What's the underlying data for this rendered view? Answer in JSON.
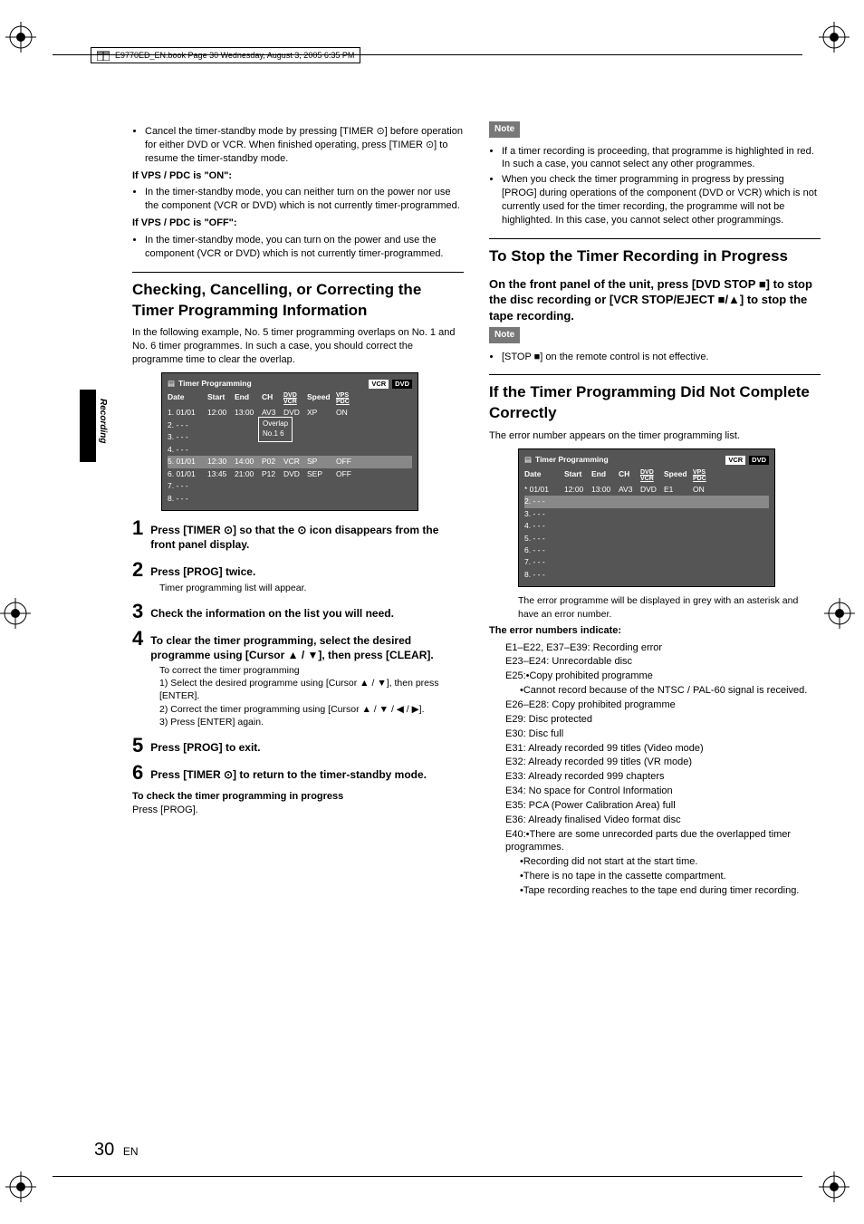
{
  "bookline": "E9770ED_EN.book  Page 30  Wednesday, August 3, 2005  6:35 PM",
  "page_number": "30",
  "page_lang": "EN",
  "sidebar": "Recording",
  "left": {
    "b1": "Cancel the timer-standby mode by pressing [TIMER ⊙] before operation for either DVD or VCR. When finished operating, press [TIMER ⊙] to resume the timer-standby mode.",
    "h_on": "If VPS / PDC is \"ON\":",
    "b2": "In the timer-standby mode, you can neither turn on the power nor use the component (VCR or DVD) which is not currently timer-programmed.",
    "h_off": "If VPS / PDC is \"OFF\":",
    "b3": "In the timer-standby mode, you can turn on the power and use the component (VCR or DVD) which is not currently timer-programmed.",
    "h2": "Checking, Cancelling, or Correcting the Timer Programming Information",
    "intro": "In the following example, No. 5 timer programming overlaps on No. 1 and No. 6 timer programmes. In such a case, you should correct the programme time to clear the overlap.",
    "timer": {
      "title": "Timer Programming",
      "badges": [
        "VCR",
        "DVD"
      ],
      "headers": [
        "Date",
        "Start",
        "End",
        "CH",
        "DVD\nVCR",
        "Speed",
        "VPS\nPDC"
      ],
      "rows": [
        [
          "1. 01/01",
          "12:00",
          "13:00",
          "AV3",
          "DVD",
          "XP",
          "ON"
        ],
        [
          "2. - - -",
          "",
          "",
          "",
          "",
          "",
          ""
        ],
        [
          "3. - - -",
          "",
          "",
          "",
          "",
          "",
          ""
        ],
        [
          "4. - - -",
          "",
          "",
          "",
          "",
          "",
          ""
        ],
        [
          "5. 01/01",
          "12:30",
          "14:00",
          "P02",
          "VCR",
          "SP",
          "OFF"
        ],
        [
          "6. 01/01",
          "13:45",
          "21:00",
          "P12",
          "DVD",
          "SEP",
          "OFF"
        ],
        [
          "7. - - -",
          "",
          "",
          "",
          "",
          "",
          ""
        ],
        [
          "8. - - -",
          "",
          "",
          "",
          "",
          "",
          ""
        ]
      ],
      "overlap_label": "Overlap",
      "overlap_ref": "No.1 6"
    },
    "steps": {
      "s1": "Press [TIMER ⊙] so that the ⊙ icon disappears from the front panel display.",
      "s2": "Press [PROG] twice.",
      "s2_sub": "Timer programming list will appear.",
      "s3": "Check the information on the list you will need.",
      "s4": "To clear the timer programming, select the desired programme using [Cursor ▲ / ▼], then press [CLEAR].",
      "s4_h": "To correct the timer programming",
      "s4_1": "1) Select the desired programme using [Cursor ▲ / ▼], then press [ENTER].",
      "s4_2": "2) Correct the timer programming using [Cursor ▲ / ▼ / ◀ / ▶].",
      "s4_3": "3) Press [ENTER] again.",
      "s5": "Press [PROG] to exit.",
      "s6": "Press [TIMER ⊙] to return to the timer-standby mode."
    },
    "check_h": "To check the timer programming in progress",
    "check_t": "Press [PROG]."
  },
  "right": {
    "note_label": "Note",
    "n1": "If a timer recording is proceeding, that programme is highlighted in red. In such a case, you cannot select any other programmes.",
    "n2": "When you check the timer programming in progress by pressing [PROG] during operations of the component (DVD or VCR) which is not currently used for the timer recording, the programme will not be highlighted. In this case, you cannot select other programmings.",
    "h2_stop": "To Stop the Timer Recording in Progress",
    "stop_h3": "On the front panel of the unit, press [DVD STOP ■] to stop the disc recording or [VCR STOP/EJECT ■/▲] to stop the tape recording.",
    "stop_note": "[STOP ■] on the remote control is not effective.",
    "h2_err": "If the Timer Programming Did Not Complete Correctly",
    "err_intro": "The error number appears on the timer programming list.",
    "timer2": {
      "title": "Timer Programming",
      "badges": [
        "VCR",
        "DVD"
      ],
      "headers": [
        "Date",
        "Start",
        "End",
        "CH",
        "DVD\nVCR",
        "Speed",
        "VPS\nPDC"
      ],
      "rows": [
        [
          "* 01/01",
          "12:00",
          "13:00",
          "AV3",
          "DVD",
          "E1",
          "ON"
        ],
        [
          "2. - - -",
          "",
          "",
          "",
          "",
          "",
          ""
        ],
        [
          "3. - - -",
          "",
          "",
          "",
          "",
          "",
          ""
        ],
        [
          "4. - - -",
          "",
          "",
          "",
          "",
          "",
          ""
        ],
        [
          "5. - - -",
          "",
          "",
          "",
          "",
          "",
          ""
        ],
        [
          "6. - - -",
          "",
          "",
          "",
          "",
          "",
          ""
        ],
        [
          "7. - - -",
          "",
          "",
          "",
          "",
          "",
          ""
        ],
        [
          "8. - - -",
          "",
          "",
          "",
          "",
          "",
          ""
        ]
      ]
    },
    "err_caption": "The error programme will be displayed in grey with an asterisk and have an error number.",
    "err_h": "The error numbers indicate:",
    "errors": [
      "E1–E22, E37–E39: Recording error",
      "E23–E24: Unrecordable disc",
      "E25:•Copy prohibited programme",
      "•Cannot record because of the NTSC / PAL-60 signal is received.",
      "E26–E28: Copy prohibited programme",
      "E29: Disc protected",
      "E30: Disc full",
      "E31: Already recorded 99 titles (Video mode)",
      "E32: Already recorded 99 titles (VR mode)",
      "E33: Already recorded 999 chapters",
      "E34: No space for Control Information",
      "E35: PCA (Power Calibration Area) full",
      "E36: Already finalised Video format disc",
      "E40:•There are some unrecorded parts due the overlapped timer programmes.",
      "•Recording did not start at the start time.",
      "•There is no tape in the cassette compartment.",
      "•Tape recording reaches to the tape end during timer recording."
    ]
  }
}
